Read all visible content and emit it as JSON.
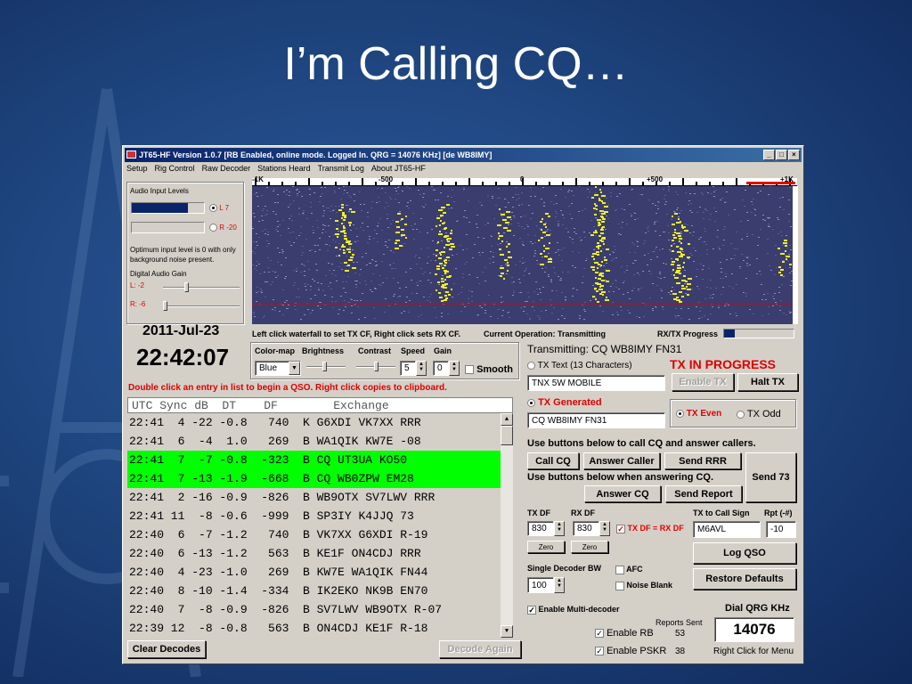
{
  "slide": {
    "title": "I’m Calling CQ…"
  },
  "window": {
    "title": "JT65-HF Version 1.0.7  [RB Enabled, online mode. Logged In. QRG = 14076 KHz] [de WB8IMY]",
    "buttons": [
      "_",
      "□",
      "×"
    ]
  },
  "menu": [
    "Setup",
    "Rig Control",
    "Raw Decoder",
    "Stations Heard",
    "Transmit Log",
    "About JT65-HF"
  ],
  "audio": {
    "title": "Audio Input Levels",
    "left_label": "L 7",
    "right_label": "R -20",
    "left_level": 0.78,
    "right_level": 0.0,
    "hint": "Optimum input level is 0 with only background noise present.",
    "gain_title": "Digital Audio Gain",
    "gain_left": "L: -2",
    "gain_right": "R: -6"
  },
  "clock": {
    "date": "2011-Jul-23",
    "time": "22:42:07"
  },
  "scale_labels": [
    "-1K",
    "-500",
    "0",
    "+500",
    "+1K"
  ],
  "status": {
    "waterfall_hint": "Left click waterfall to set TX CF, Right click sets RX CF.",
    "operation": "Current Operation:  Transmitting",
    "progress_label": "RX/TX Progress",
    "progress": 0.15
  },
  "controls": {
    "colormap_label": "Color-map",
    "brightness_label": "Brightness",
    "contrast_label": "Contrast",
    "speed_label": "Speed",
    "gain_label": "Gain",
    "colormap_value": "Blue",
    "speed_value": "5",
    "gain_value": "0",
    "smooth_label": "Smooth"
  },
  "decodes": {
    "hint": "Double click an entry in list to begin a QSO.  Right click copies to clipboard.",
    "header": "UTC Sync dB  DT    DF        Exchange",
    "rows": [
      {
        "text": "22:41  4 -22 -0.8   740  K G6XDI VK7XX RRR",
        "highlight": false
      },
      {
        "text": "22:41  6  -4  1.0   269  B WA1QIK KW7E -08",
        "highlight": false
      },
      {
        "text": "22:41  7  -7 -0.8  -323  B CQ UT3UA KO50",
        "highlight": true
      },
      {
        "text": "22:41  7 -13 -1.9  -668  B CQ WB0ZPW EM28",
        "highlight": true
      },
      {
        "text": "22:41  2 -16 -0.9  -826  B WB9OTX SV7LWV RRR",
        "highlight": false
      },
      {
        "text": "22:41 11  -8 -0.6  -999  B SP3IY K4JJQ 73",
        "highlight": false
      },
      {
        "text": "22:40  6  -7 -1.2   740  B VK7XX G6XDI R-19",
        "highlight": false
      },
      {
        "text": "22:40  6 -13 -1.2   563  B KE1F ON4CDJ RRR",
        "highlight": false
      },
      {
        "text": "22:40  4 -23 -1.0   269  B KW7E WA1QIK FN44",
        "highlight": false
      },
      {
        "text": "22:40  8 -10 -1.4  -334  B IK2EKO NK9B EN70",
        "highlight": false
      },
      {
        "text": "22:40  7  -8 -0.9  -826  B SV7LWV WB9OTX R-07",
        "highlight": false
      },
      {
        "text": "22:39 12  -8 -0.8   563  B ON4CDJ KE1F R-18",
        "highlight": false
      }
    ]
  },
  "buttons": {
    "clear_decodes": "Clear Decodes",
    "decode_again": "Decode Again",
    "enable_tx": "Enable TX",
    "halt_tx": "Halt TX",
    "call_cq": "Call CQ",
    "answer_caller": "Answer Caller",
    "send_rrr": "Send RRR",
    "send_73": "Send 73",
    "answer_cq": "Answer CQ",
    "send_report": "Send Report",
    "zero1": "Zero",
    "zero2": "Zero",
    "log_qso": "Log QSO",
    "restore_defaults": "Restore Defaults"
  },
  "tx": {
    "transmitting": "Transmitting: CQ WB8IMY FN31",
    "tx_text_label": "TX Text (13 Characters)",
    "in_progress": "TX IN PROGRESS",
    "text_field": "TNX 5W MOBILE",
    "generated_label": "TX Generated",
    "generated_field": "CQ WB8IMY FN31",
    "even_label": "TX Even",
    "odd_label": "TX Odd",
    "hint_call": "Use buttons below to call CQ and answer callers.",
    "hint_answer": "Use buttons below when answering CQ.",
    "txdf_label": "TX DF",
    "rxdf_label": "RX DF",
    "txdf_value": "830",
    "rxdf_value": "830",
    "txdf_eq_label": "TX DF = RX DF",
    "call_sign_label": "TX to Call Sign",
    "rpt_label": "Rpt (-#)",
    "call_sign_value": "M6AVL",
    "rpt_value": "-10",
    "bw_label": "Single Decoder BW",
    "bw_value": "100",
    "afc_label": "AFC",
    "noise_label": "Noise Blank",
    "multi_label": "Enable Multi-decoder",
    "reports_sent": "Reports Sent",
    "rb_label": "Enable RB",
    "rb_count": "53",
    "pskr_label": "Enable PSKR",
    "pskr_count": "38",
    "dial_label": "Dial QRG KHz",
    "dial_value": "14076",
    "dial_hint": "Right Click for Menu"
  },
  "colors": {
    "highlight": "#00ff00",
    "alert": "#e00000",
    "titlebar": "#0a246a",
    "waterfall": "#3a3d6e",
    "signal": "#f0f020"
  }
}
